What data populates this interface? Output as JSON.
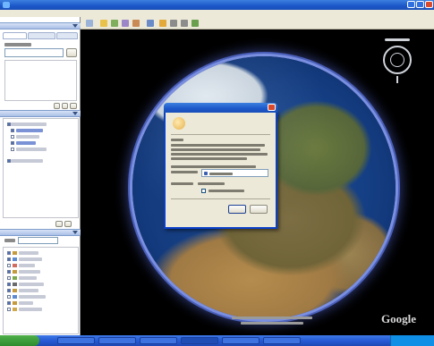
{
  "window": {
    "title": "",
    "colors": {
      "titlebar": "#1c57c8",
      "chrome": "#ece9d8",
      "globe_halo": "#7a8fe0"
    }
  },
  "toolbar": {
    "icons": [
      "hide-sidebar-icon",
      "placemark-icon",
      "polygon-icon",
      "path-icon",
      "overlay-icon",
      "tour-icon",
      "sun-icon",
      "email-icon",
      "print-icon",
      "maps-icon"
    ]
  },
  "sidebar": {
    "search": {
      "tabs": [
        "",
        "",
        ""
      ],
      "query": "",
      "placeholder": ""
    },
    "places": {
      "title": ""
    },
    "layers": {
      "title": "",
      "view_select": ""
    }
  },
  "viewer": {
    "logo_text": "Google",
    "coordinates_text": ""
  },
  "dialog": {
    "title": "",
    "message": "",
    "option_label": "",
    "checkbox_label": "",
    "ok_label": "",
    "cancel_label": ""
  },
  "taskbar": {
    "start_label": "",
    "clock": ""
  }
}
